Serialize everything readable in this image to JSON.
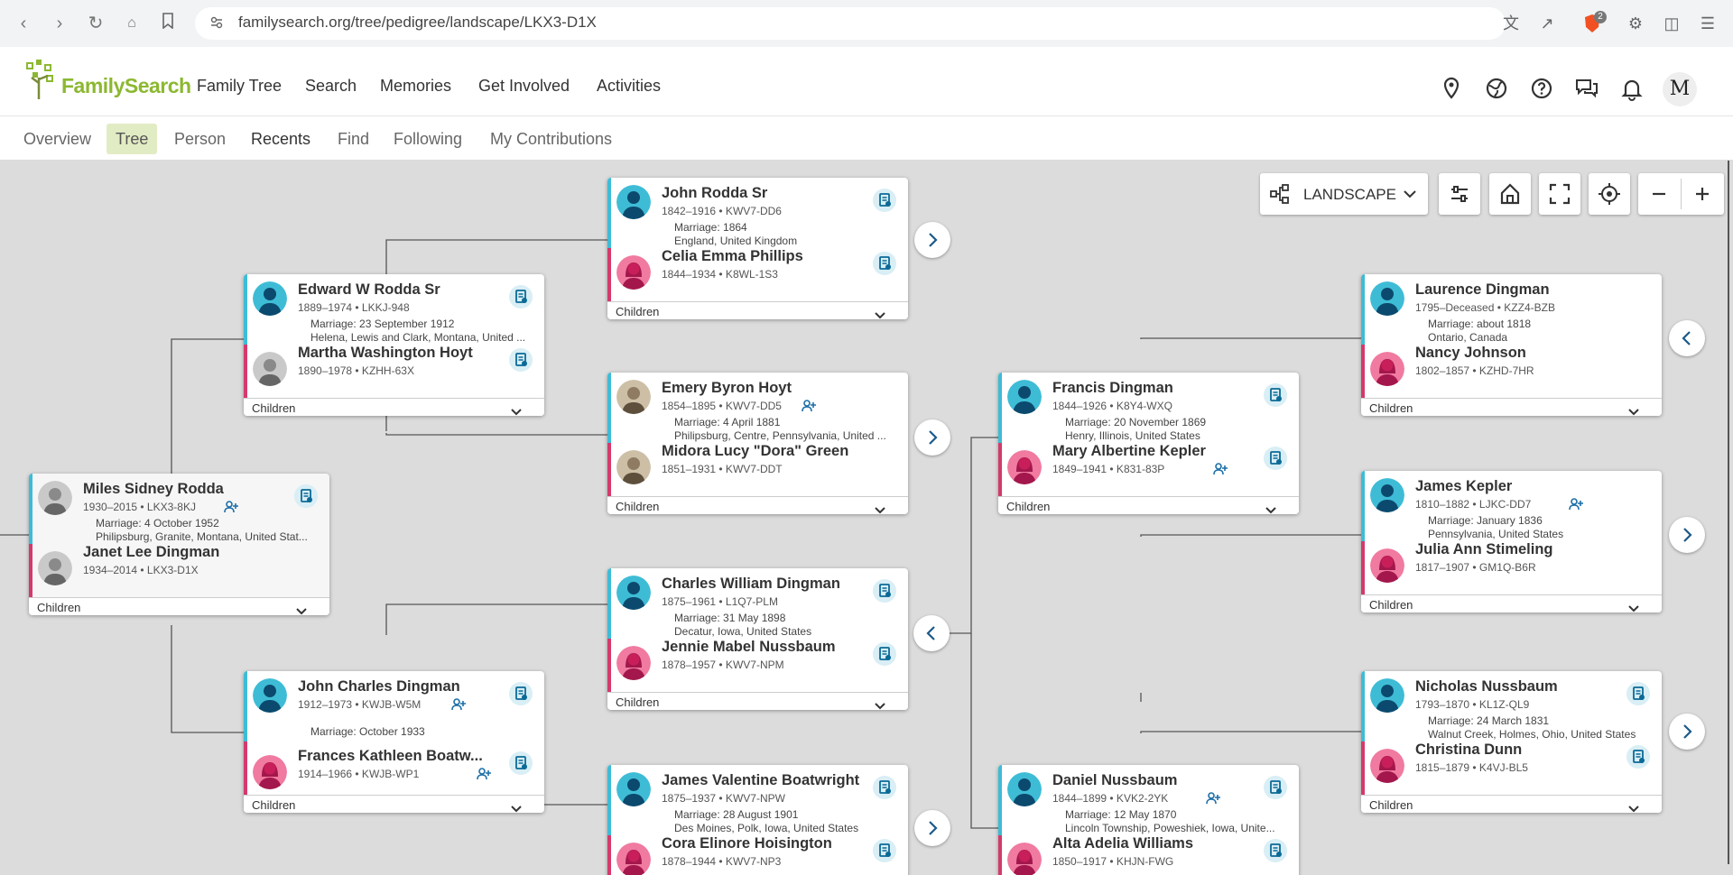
{
  "browser": {
    "url": "familysearch.org/tree/pedigree/landscape/LKX3-D1X",
    "brave_badge": "2"
  },
  "header": {
    "brand": "FamilySearch",
    "nav": [
      "Family Tree",
      "Search",
      "Memories",
      "Get Involved",
      "Activities"
    ],
    "avatar_letter": "M"
  },
  "subnav": {
    "items": [
      "Overview",
      "Tree",
      "Person",
      "Recents",
      "Find",
      "Following",
      "My Contributions"
    ],
    "active": "Tree"
  },
  "toolbar": {
    "view_label": "LANDSCAPE"
  },
  "children_label": "Children",
  "families": [
    {
      "father": {
        "name": "Miles Sidney Rodda",
        "life": "1930–2015 • LKX3-8KJ"
      },
      "marriage": "Marriage: 4 October 1952",
      "place": "Philipsburg, Granite, Montana, United Stat...",
      "mother": {
        "name": "Janet Lee Dingman",
        "life": "1934–2014 • LKX3-D1X"
      }
    },
    {
      "father": {
        "name": "Edward W Rodda Sr",
        "life": "1889–1974 • LKKJ-948"
      },
      "marriage": "Marriage: 23 September 1912",
      "place": "Helena, Lewis and Clark, Montana, United ...",
      "mother": {
        "name": "Martha Washington Hoyt",
        "life": "1890–1978 • KZHH-63X"
      }
    },
    {
      "father": {
        "name": "John Charles Dingman",
        "life": "1912–1973 • KWJB-W5M"
      },
      "marriage": "Marriage: October 1933",
      "place": "",
      "mother": {
        "name": "Frances Kathleen Boatw...",
        "life": "1914–1966 • KWJB-WP1"
      }
    },
    {
      "father": {
        "name": "John Rodda Sr",
        "life": "1842–1916 • KWV7-DD6"
      },
      "marriage": "Marriage: 1864",
      "place": "England, United Kingdom",
      "mother": {
        "name": "Celia Emma Phillips",
        "life": "1844–1934 • K8WL-1S3"
      }
    },
    {
      "father": {
        "name": "Emery Byron Hoyt",
        "life": "1854–1895 • KWV7-DD5"
      },
      "marriage": "Marriage: 4 April 1881",
      "place": "Philipsburg, Centre, Pennsylvania, United ...",
      "mother": {
        "name": "Midora Lucy \"Dora\" Green",
        "life": "1851–1931 • KWV7-DDT"
      }
    },
    {
      "father": {
        "name": "Charles William Dingman",
        "life": "1875–1961 • L1Q7-PLM"
      },
      "marriage": "Marriage: 31 May 1898",
      "place": "Decatur, Iowa, United States",
      "mother": {
        "name": "Jennie Mabel Nussbaum",
        "life": "1878–1957 • KWV7-NPM"
      }
    },
    {
      "father": {
        "name": "James Valentine Boatwright",
        "life": "1875–1937 • KWV7-NPW"
      },
      "marriage": "Marriage: 28 August 1901",
      "place": "Des Moines, Polk, Iowa, United States",
      "mother": {
        "name": "Cora Elinore Hoisington",
        "life": "1878–1944 • KWV7-NP3"
      }
    },
    {
      "father": {
        "name": "Francis Dingman",
        "life": "1844–1926 • K8Y4-WXQ"
      },
      "marriage": "Marriage: 20 November 1869",
      "place": "Henry, Illinois, United States",
      "mother": {
        "name": "Mary Albertine Kepler",
        "life": "1849–1941 • K831-83P"
      }
    },
    {
      "father": {
        "name": "Daniel Nussbaum",
        "life": "1844–1899 • KVK2-2YK"
      },
      "marriage": "Marriage: 12 May 1870",
      "place": "Lincoln Township, Poweshiek, Iowa, Unite...",
      "mother": {
        "name": "Alta Adelia Williams",
        "life": "1850–1917 • KHJN-FWG"
      }
    },
    {
      "father": {
        "name": "Laurence Dingman",
        "life": "1795–Deceased • KZZ4-BZB"
      },
      "marriage": "Marriage: about 1818",
      "place": "Ontario, Canada",
      "mother": {
        "name": "Nancy Johnson",
        "life": "1802–1857 • KZHD-7HR"
      }
    },
    {
      "father": {
        "name": "James Kepler",
        "life": "1810–1882 • LJKC-DD7"
      },
      "marriage": "Marriage: January 1836",
      "place": "Pennsylvania, United States",
      "mother": {
        "name": "Julia Ann Stimeling",
        "life": "1817–1907 • GM1Q-B6R"
      }
    },
    {
      "father": {
        "name": "Nicholas Nussbaum",
        "life": "1793–1870 • KL1Z-QL9"
      },
      "marriage": "Marriage: 24 March 1831",
      "place": "Walnut Creek, Holmes, Ohio, United States",
      "mother": {
        "name": "Christina Dunn",
        "life": "1815–1879 • K4VJ-BL5"
      }
    }
  ]
}
